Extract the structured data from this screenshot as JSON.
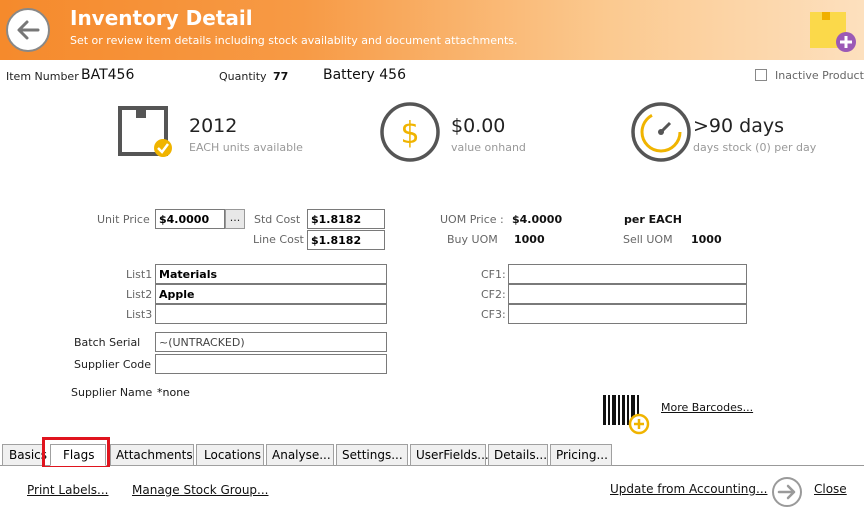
{
  "header": {
    "title": "Inventory Detail",
    "subtitle": "Set or review item details including stock availablity and document attachments."
  },
  "item": {
    "number_label": "Item Number",
    "number": "BAT456",
    "quantity_label": "Quantity",
    "quantity": "77",
    "name": "Battery 456",
    "inactive_label": "Inactive Product",
    "inactive": false
  },
  "stats": [
    {
      "value": "2012",
      "caption": "EACH units available"
    },
    {
      "value": "$0.00",
      "caption": "value onhand"
    },
    {
      "value": ">90 days",
      "caption": "days stock (0) per day"
    }
  ],
  "pricing": {
    "unit_price_label": "Unit Price",
    "unit_price": "$4.0000",
    "ellipsis_label": "...",
    "std_cost_label": "Std Cost",
    "std_cost": "$1.8182",
    "line_cost_label": "Line Cost",
    "line_cost": "$1.8182",
    "uom_price_label": "UOM Price :",
    "uom_price": "$4.0000",
    "per_label": "per EACH",
    "buy_uom_label": "Buy UOM",
    "buy_uom": "1000",
    "sell_uom_label": "Sell UOM",
    "sell_uom": "1000"
  },
  "lists": {
    "list1_label": "List1",
    "list1": "Materials",
    "list2_label": "List2",
    "list2": "Apple",
    "list3_label": "List3",
    "list3": "",
    "cf1_label": "CF1:",
    "cf1": "",
    "cf2_label": "CF2:",
    "cf2": "",
    "cf3_label": "CF3:",
    "cf3": ""
  },
  "supplier": {
    "batch_label": "Batch Serial",
    "batch": "~(UNTRACKED)",
    "code_label": "Supplier Code",
    "code": "",
    "name_label": "Supplier Name",
    "name": "*none"
  },
  "barcodes_link": "More Barcodes...",
  "tabs": [
    "Basics",
    "Flags",
    "Attachments",
    "Locations",
    "Analyse...",
    "Settings...",
    "UserFields...",
    "Details...",
    "Pricing..."
  ],
  "footer": {
    "print_labels": "Print Labels...",
    "manage_group": "Manage Stock Group...",
    "update_accounting": "Update from Accounting...",
    "close": "Close"
  }
}
